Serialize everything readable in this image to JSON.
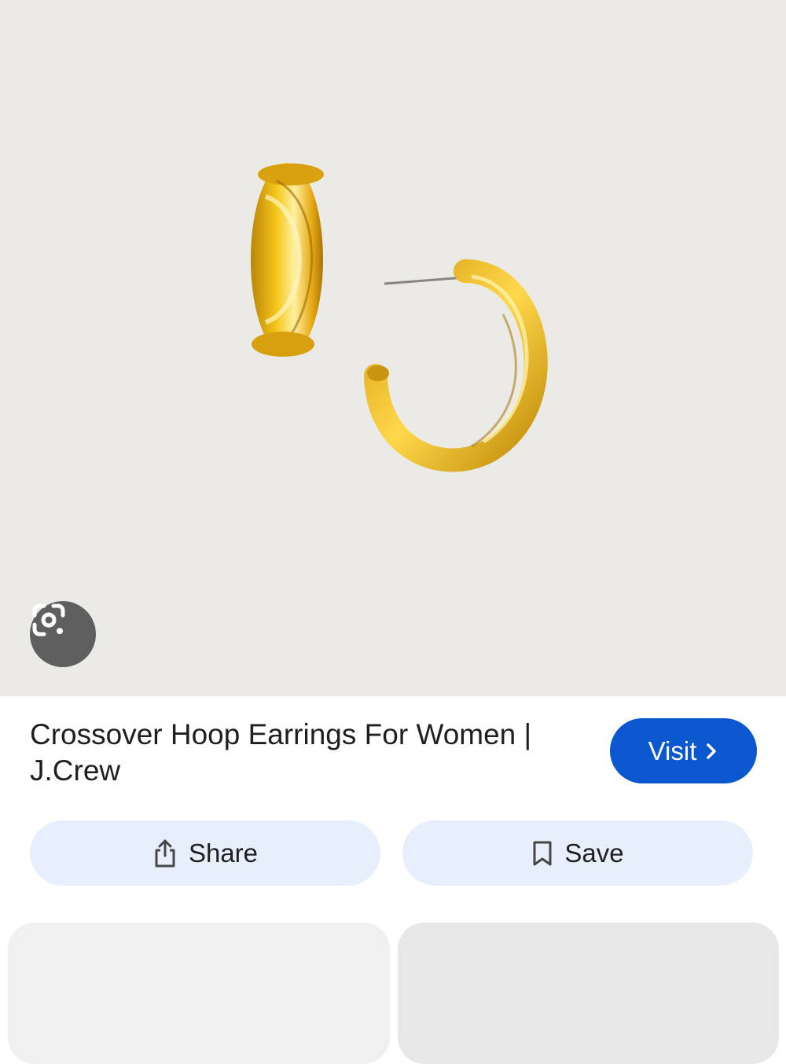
{
  "product": {
    "title": "Crossover Hoop Earrings For Women | J.Crew"
  },
  "actions": {
    "visit_label": "Visit",
    "share_label": "Share",
    "save_label": "Save"
  },
  "icons": {
    "lens": "google-lens-icon",
    "visit": "chevron-right-icon",
    "share": "share-icon",
    "save": "bookmark-icon"
  },
  "colors": {
    "image_background": "#eceae6",
    "gold": "#e9b31c",
    "visit_button": "#0b57d0",
    "action_button": "#e8effc",
    "lens_button": "#5f5f5f"
  }
}
